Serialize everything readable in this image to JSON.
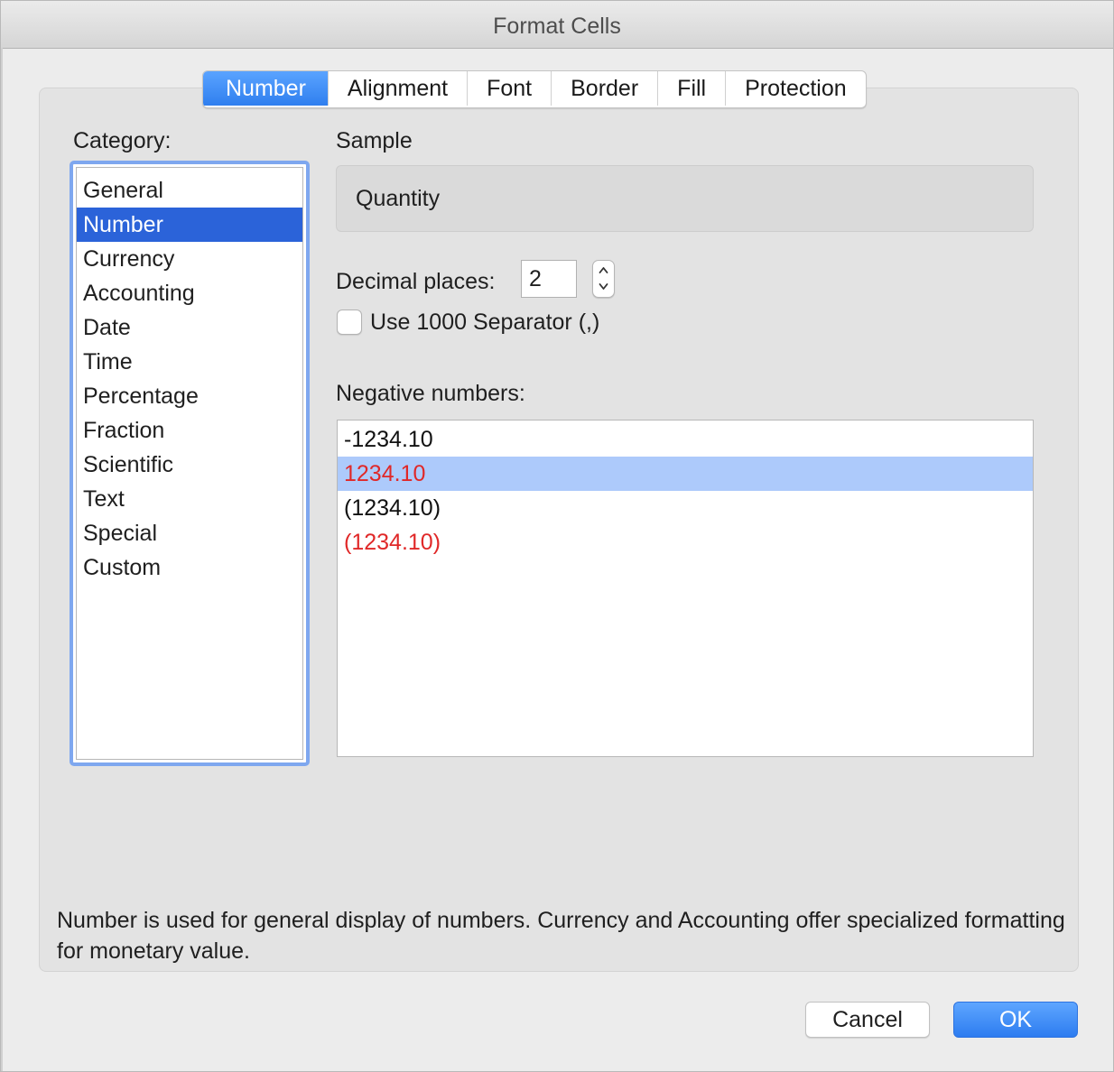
{
  "window": {
    "title": "Format Cells"
  },
  "tabs": [
    {
      "label": "Number",
      "active": true
    },
    {
      "label": "Alignment",
      "active": false
    },
    {
      "label": "Font",
      "active": false
    },
    {
      "label": "Border",
      "active": false
    },
    {
      "label": "Fill",
      "active": false
    },
    {
      "label": "Protection",
      "active": false
    }
  ],
  "category": {
    "label": "Category:",
    "selected": "Number",
    "items": [
      "General",
      "Number",
      "Currency",
      "Accounting",
      "Date",
      "Time",
      "Percentage",
      "Fraction",
      "Scientific",
      "Text",
      "Special",
      "Custom"
    ]
  },
  "sample": {
    "label": "Sample",
    "value": "Quantity"
  },
  "decimal_places": {
    "label": "Decimal places:",
    "value": "2"
  },
  "separator": {
    "label": "Use 1000 Separator (,)",
    "checked": false
  },
  "negative_numbers": {
    "label": "Negative numbers:",
    "items": [
      {
        "text": "-1234.10",
        "color": "#111111",
        "selected": false
      },
      {
        "text": "1234.10",
        "color": "#e02828",
        "selected": true
      },
      {
        "text": "(1234.10)",
        "color": "#111111",
        "selected": false
      },
      {
        "text": "(1234.10)",
        "color": "#e02828",
        "selected": false
      }
    ]
  },
  "description": "Number is used for general display of numbers.  Currency and Accounting offer specialized formatting for monetary value.",
  "buttons": {
    "cancel": "Cancel",
    "ok": "OK"
  },
  "colors": {
    "accent": "#2f7fef",
    "selection": "#2b63d9",
    "list_selection": "#adcafb",
    "negative_red": "#e02828"
  }
}
